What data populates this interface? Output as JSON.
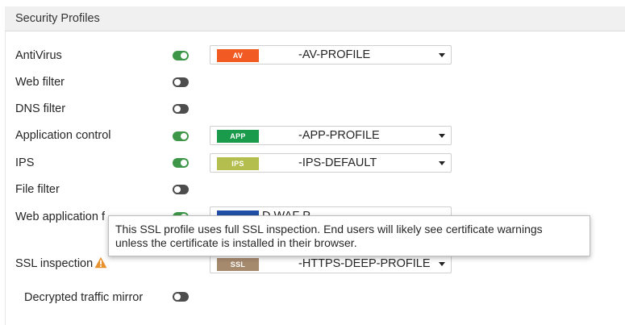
{
  "section": {
    "title": "Security Profiles"
  },
  "rows": [
    {
      "label": "AntiVirus",
      "enabled": true,
      "badge": "AV",
      "badge_color": "#f15a22",
      "value": "-AV-PROFILE"
    },
    {
      "label": "Web filter",
      "enabled": false
    },
    {
      "label": "DNS filter",
      "enabled": false
    },
    {
      "label": "Application control",
      "enabled": true,
      "badge": "APP",
      "badge_color": "#1a9a4b",
      "value": "-APP-PROFILE"
    },
    {
      "label": "IPS",
      "enabled": true,
      "badge": "IPS",
      "badge_color": "#b3be4e",
      "value": "-IPS-DEFAULT"
    },
    {
      "label": "File filter",
      "enabled": false
    },
    {
      "label": "Web application f",
      "enabled": true,
      "badge": "",
      "badge_color": "#1f4fa8",
      "value": "D     WAF P"
    },
    {
      "label": "SSL inspection",
      "enabled": true,
      "badge": "SSL",
      "badge_color": "#a68a6e",
      "value": "-HTTPS-DEEP-PROFILE"
    },
    {
      "label": "Decrypted traffic mirror",
      "enabled": false
    }
  ],
  "icons": {
    "warning": "warning-triangle-icon",
    "warning_color": "#e8912d"
  },
  "tooltip": {
    "line1": "This SSL profile uses full SSL inspection. End users will likely see certificate warnings",
    "line2": "unless the certificate is installed in their browser."
  }
}
